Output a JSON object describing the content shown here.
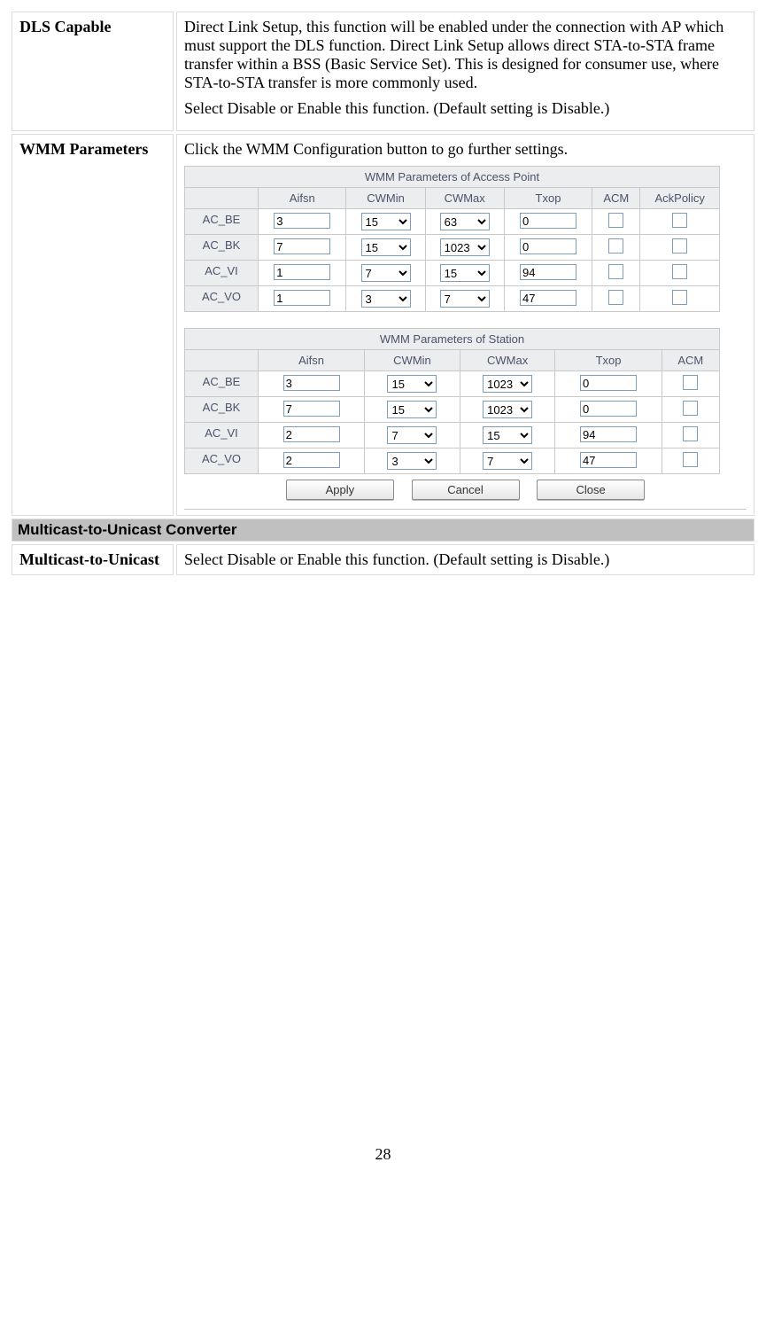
{
  "rows": {
    "dls": {
      "label": "DLS Capable",
      "p1": "Direct Link Setup, this function will be enabled under the connection with AP which must support the DLS function. Direct Link Setup allows direct STA-to-STA frame transfer within a BSS (Basic Service Set). This is designed for consumer use, where STA-to-STA transfer is more commonly used.",
      "p2": "Select Disable or Enable this function. (Default setting is Disable.)"
    },
    "wmm": {
      "label": "WMM Parameters",
      "intro": "Click the WMM Configuration button to go further settings."
    },
    "m2u": {
      "section": "Multicast-to-Unicast Converter",
      "label": "Multicast-to-Unicast",
      "desc": "Select Disable or Enable this function. (Default setting is Disable.)"
    }
  },
  "ap": {
    "title": "WMM Parameters of Access Point",
    "headers": [
      "Aifsn",
      "CWMin",
      "CWMax",
      "Txop",
      "ACM",
      "AckPolicy"
    ],
    "rows": [
      {
        "name": "AC_BE",
        "aifsn": "3",
        "cwmin": "15",
        "cwmax": "63",
        "txop": "0"
      },
      {
        "name": "AC_BK",
        "aifsn": "7",
        "cwmin": "15",
        "cwmax": "1023",
        "txop": "0"
      },
      {
        "name": "AC_VI",
        "aifsn": "1",
        "cwmin": "7",
        "cwmax": "15",
        "txop": "94"
      },
      {
        "name": "AC_VO",
        "aifsn": "1",
        "cwmin": "3",
        "cwmax": "7",
        "txop": "47"
      }
    ]
  },
  "sta": {
    "title": "WMM Parameters of Station",
    "headers": [
      "Aifsn",
      "CWMin",
      "CWMax",
      "Txop",
      "ACM"
    ],
    "rows": [
      {
        "name": "AC_BE",
        "aifsn": "3",
        "cwmin": "15",
        "cwmax": "1023",
        "txop": "0"
      },
      {
        "name": "AC_BK",
        "aifsn": "7",
        "cwmin": "15",
        "cwmax": "1023",
        "txop": "0"
      },
      {
        "name": "AC_VI",
        "aifsn": "2",
        "cwmin": "7",
        "cwmax": "15",
        "txop": "94"
      },
      {
        "name": "AC_VO",
        "aifsn": "2",
        "cwmin": "3",
        "cwmax": "7",
        "txop": "47"
      }
    ]
  },
  "buttons": {
    "apply": "Apply",
    "cancel": "Cancel",
    "close": "Close"
  },
  "page_number": "28"
}
